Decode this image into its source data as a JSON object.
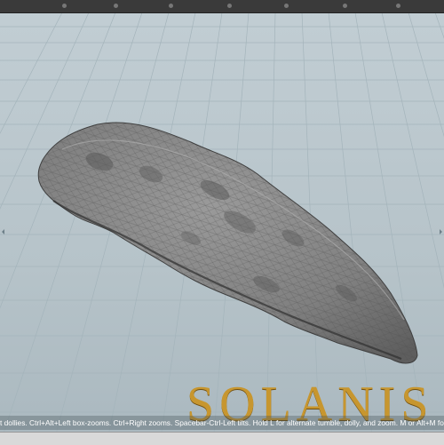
{
  "logo": {
    "text": "SOLANIS"
  },
  "status": {
    "hint": "t dollies. Ctrl+Alt+Left box-zooms. Ctrl+Right zooms. Spacebar-Ctrl-Left tilts. Hold L for alternate tumble, dolly, and zoom. M or Alt+M for First Person Navigat"
  },
  "icons": {
    "viewport": "3d-viewport",
    "handle_left": "viewport-edge-handle-icon",
    "handle_right": "viewport-edge-handle-icon"
  },
  "colors": {
    "background": "#b9c6cc",
    "grid_line": "#9fb0b8",
    "mesh_fill": "#7d7d7d",
    "mesh_wire": "#4a4a4a",
    "logo_gold": "#c7962f"
  }
}
